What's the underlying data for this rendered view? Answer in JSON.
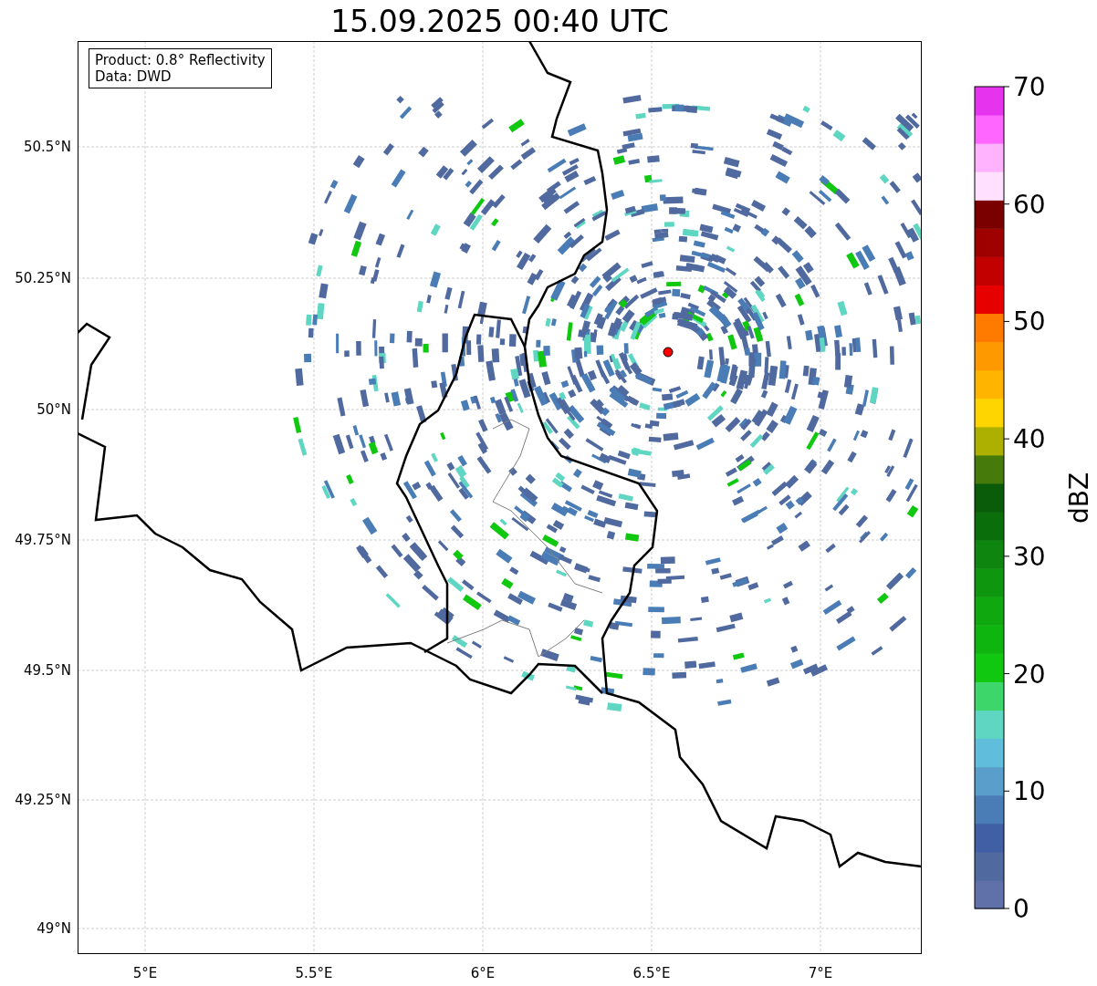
{
  "title": "15.09.2025 00:40 UTC",
  "info_box": {
    "lines": [
      "Product: 0.8° Reflectivity",
      "Data: DWD"
    ]
  },
  "y_ticks": [
    "50.5°N",
    "50.25°N",
    "50°N",
    "49.75°N",
    "49.5°N",
    "49.25°N",
    "49°N"
  ],
  "x_ticks": [
    "5°E",
    "5.5°E",
    "6°E",
    "6.5°E",
    "7°E"
  ],
  "colorbar": {
    "label": "dBZ",
    "ticks": [
      "70",
      "60",
      "50",
      "40",
      "30",
      "20",
      "10",
      "0"
    ]
  }
}
